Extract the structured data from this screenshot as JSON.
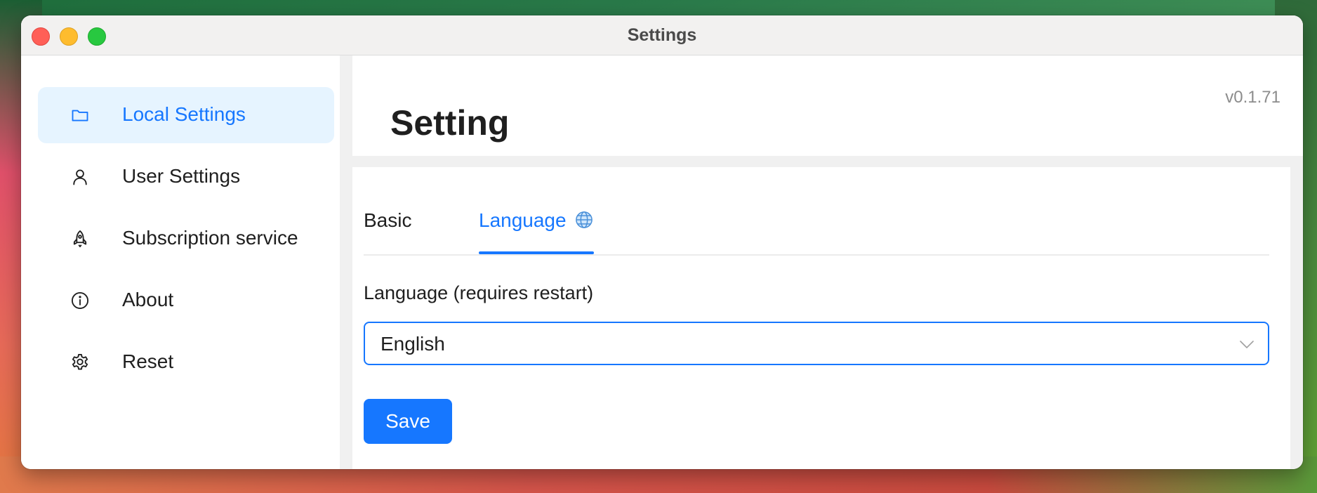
{
  "window": {
    "title": "Settings"
  },
  "sidebar": {
    "items": [
      {
        "label": "Local Settings",
        "icon": "folder-icon",
        "active": true
      },
      {
        "label": "User Settings",
        "icon": "user-icon",
        "active": false
      },
      {
        "label": "Subscription service",
        "icon": "rocket-icon",
        "active": false
      },
      {
        "label": "About",
        "icon": "info-icon",
        "active": false
      },
      {
        "label": "Reset",
        "icon": "gear-icon",
        "active": false
      }
    ]
  },
  "header": {
    "version": "v0.1.71",
    "title": "Setting"
  },
  "tabs": [
    {
      "label": "Basic",
      "active": false
    },
    {
      "label": "Language",
      "icon": "globe-icon",
      "active": true
    }
  ],
  "form": {
    "language_label": "Language (requires restart)",
    "language_value": "English",
    "save_label": "Save"
  },
  "colors": {
    "accent": "#1677ff",
    "active_bg": "#e6f4ff"
  }
}
